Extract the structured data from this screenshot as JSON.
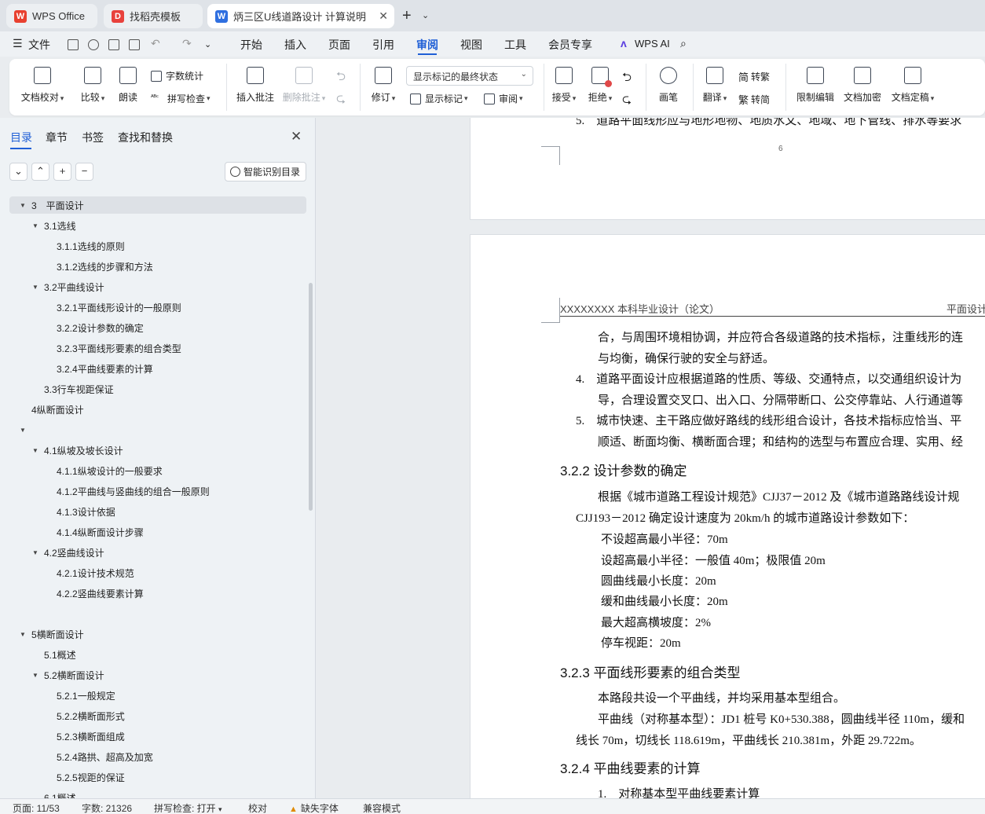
{
  "tabs": [
    {
      "label": "WPS Office",
      "icon": "wps-logo-icon"
    },
    {
      "label": "找稻壳模板",
      "icon": "docer-icon"
    },
    {
      "label": "炳三区U线道路设计 计算说明",
      "icon": "writer-doc-icon"
    }
  ],
  "menu": {
    "file": "文件",
    "items": [
      "开始",
      "插入",
      "页面",
      "引用",
      "审阅",
      "视图",
      "工具",
      "会员专享"
    ],
    "active": "审阅",
    "wps_ai": "WPS AI"
  },
  "ribbon": {
    "doc_check": "文档校对",
    "compare": "比较",
    "read_aloud": "朗读",
    "word_count": "字数统计",
    "spell_check": "拼写检查",
    "insert_comment": "插入批注",
    "delete_comment": "删除批注",
    "track_changes": "修订",
    "markup_state": "显示标记的最终状态",
    "show_markup": "显示标记",
    "review": "审阅",
    "accept": "接受",
    "reject": "拒绝",
    "pen": "画笔",
    "translate": "翻译",
    "to_traditional": "转繁",
    "to_simplified": "转简",
    "restrict_edit": "限制编辑",
    "encrypt": "文档加密",
    "finalize": "文档定稿"
  },
  "nav": {
    "tabs": [
      "目录",
      "章节",
      "书签",
      "查找和替换"
    ],
    "smart_btn": "智能识别目录",
    "toc": [
      {
        "label": "3　平面设计",
        "level": 0,
        "arrow": "▼",
        "selected": true
      },
      {
        "label": "3.1选线",
        "level": 1,
        "arrow": "▼"
      },
      {
        "label": "3.1.1选线的原则",
        "level": 2,
        "arrow": ""
      },
      {
        "label": "3.1.2选线的步骤和方法",
        "level": 2,
        "arrow": ""
      },
      {
        "label": "3.2平曲线设计",
        "level": 1,
        "arrow": "▼"
      },
      {
        "label": "3.2.1平面线形设计的一般原则",
        "level": 2,
        "arrow": ""
      },
      {
        "label": "3.2.2设计参数的确定",
        "level": 2,
        "arrow": ""
      },
      {
        "label": "3.2.3平面线形要素的组合类型",
        "level": 2,
        "arrow": ""
      },
      {
        "label": "3.2.4平曲线要素的计算",
        "level": 2,
        "arrow": ""
      },
      {
        "label": "3.3行车视距保证",
        "level": 1,
        "arrow": ""
      },
      {
        "label": "4纵断面设计",
        "level": 0,
        "arrow": ""
      },
      {
        "label": "",
        "level": 0,
        "arrow": "▼"
      },
      {
        "label": "4.1纵坡及坡长设计",
        "level": 1,
        "arrow": "▼"
      },
      {
        "label": "4.1.1纵坡设计的一般要求",
        "level": 2,
        "arrow": ""
      },
      {
        "label": "4.1.2平曲线与竖曲线的组合一般原则",
        "level": 2,
        "arrow": ""
      },
      {
        "label": "4.1.3设计依据",
        "level": 2,
        "arrow": ""
      },
      {
        "label": "4.1.4纵断面设计步骤",
        "level": 2,
        "arrow": ""
      },
      {
        "label": "4.2竖曲线设计",
        "level": 1,
        "arrow": "▼"
      },
      {
        "label": "4.2.1设计技术规范",
        "level": 2,
        "arrow": ""
      },
      {
        "label": "4.2.2竖曲线要素计算",
        "level": 2,
        "arrow": ""
      },
      {
        "label": "",
        "level": 0,
        "arrow": ""
      },
      {
        "label": "5横断面设计",
        "level": 0,
        "arrow": "▼"
      },
      {
        "label": "5.1概述",
        "level": 1,
        "arrow": ""
      },
      {
        "label": "5.2横断面设计",
        "level": 1,
        "arrow": "▼"
      },
      {
        "label": "5.2.1一般规定",
        "level": 2,
        "arrow": ""
      },
      {
        "label": "5.2.2横断面形式",
        "level": 2,
        "arrow": ""
      },
      {
        "label": "5.2.3横断面组成",
        "level": 2,
        "arrow": ""
      },
      {
        "label": "5.2.4路拱、超高及加宽",
        "level": 2,
        "arrow": ""
      },
      {
        "label": "5.2.5视距的保证",
        "level": 2,
        "arrow": ""
      },
      {
        "label": "6.1概述",
        "level": 1,
        "arrow": ""
      }
    ]
  },
  "doc": {
    "page1_partial_line": "5.　道路平面线形应与地形地物、地质水文、地域、地下管线、排水等要求",
    "page1_number": "6",
    "header_left": "XXXXXXXX 本科毕业设计（论文）",
    "header_right": "平面设计",
    "lines": [
      "合，与周围环境相协调，并应符合各级道路的技术指标，注重线形的连",
      "与均衡，确保行驶的安全与舒适。",
      "4.　道路平面设计应根据道路的性质、等级、交通特点，以交通组织设计为",
      "导，合理设置交叉口、出入口、分隔带断口、公交停靠站、人行通道等",
      "5.　城市快速、主干路应做好路线的线形组合设计，各技术指标应恰当、平",
      "顺适、断面均衡、横断面合理；和结构的选型与布置应合理、实用、经"
    ],
    "h_322": "3.2.2  设计参数的确定",
    "p_322a": "根据《城市道路工程设计规范》CJJ37－2012 及《城市道路路线设计规",
    "p_322b": "CJJ193－2012 确定设计速度为 20km/h 的城市道路设计参数如下：",
    "params": [
      "不设超高最小半径：70m",
      "设超高最小半径：一般值 40m；极限值 20m",
      "圆曲线最小长度：20m",
      "缓和曲线最小长度：20m",
      "最大超高横坡度：2%",
      "停车视距：20m"
    ],
    "h_323": "3.2.3  平面线形要素的组合类型",
    "p_323a": "本路段共设一个平曲线，并均采用基本型组合。",
    "p_323b": "平曲线（对称基本型）：JD1 桩号 K0+530.388，圆曲线半径 110m，缓和",
    "p_323c": "线长 70m，切线长 118.619m，平曲线长 210.381m，外距 29.722m。",
    "h_324": "3.2.4  平曲线要素的计算",
    "p_324a": "1.　对称基本型平曲线要素计算"
  },
  "status": {
    "page": "页面: 11/53",
    "words": "字数: 21326",
    "spell": "拼写检查: 打开",
    "proofread": "校对",
    "missing_font": "缺失字体",
    "compat": "兼容模式"
  },
  "colors": {
    "accent": "#1f5fd6",
    "wps_red": "#e8402f",
    "docer_red": "#e8413c",
    "writer_blue": "#2f6fe0"
  }
}
